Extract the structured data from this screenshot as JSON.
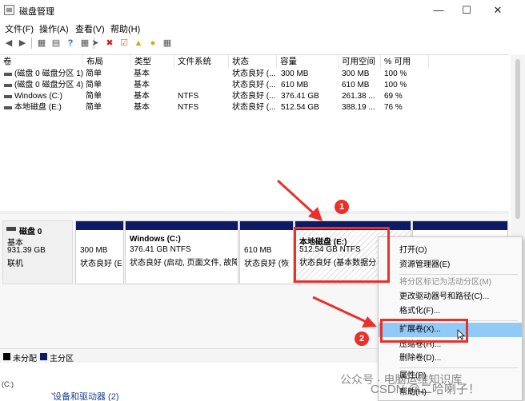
{
  "window": {
    "title": "磁盘管理",
    "controls": {
      "minimize": "—",
      "maximize": "☐",
      "close": "✕"
    }
  },
  "menu": [
    "文件(F)",
    "操作(A)",
    "查看(V)",
    "帮助(H)"
  ],
  "toolbar": {
    "icons": [
      "back-icon",
      "forward-icon",
      "console-tree-icon",
      "properties-icon",
      "help-icon",
      "view-icon",
      "connect-icon",
      "delete-icon",
      "checklist-icon",
      "open-folder-icon",
      "search-folder-icon",
      "options-icon"
    ]
  },
  "volume_table": {
    "columns": [
      "卷",
      "布局",
      "类型",
      "文件系统",
      "状态",
      "容量",
      "可用空间",
      "% 可用"
    ],
    "rows": [
      [
        "(磁盘 0 磁盘分区 1)",
        "简单",
        "基本",
        "",
        "状态良好 (...",
        "300 MB",
        "300 MB",
        "100 %"
      ],
      [
        "(磁盘 0 磁盘分区 4)",
        "简单",
        "基本",
        "",
        "状态良好 (...",
        "610 MB",
        "610 MB",
        "100 %"
      ],
      [
        "Windows (C:)",
        "简单",
        "基本",
        "NTFS",
        "状态良好 (...",
        "376.41 GB",
        "261.38 ...",
        "69 %"
      ],
      [
        "本地磁盘 (E:)",
        "简单",
        "基本",
        "NTFS",
        "状态良好 (...",
        "512.54 GB",
        "388.19 ...",
        "76 %"
      ]
    ]
  },
  "disk": {
    "name": "磁盘 0",
    "type": "基本",
    "size": "931.39 GB",
    "status": "联机",
    "partitions": [
      {
        "title": "",
        "size": "300 MB",
        "status": "状态良好 (E"
      },
      {
        "title": "Windows  (C:)",
        "size": "376.41 GB NTFS",
        "status": "状态良好 (启动, 页面文件, 故障"
      },
      {
        "title": "",
        "size": "610 MB",
        "status": "状态良好 (恢"
      },
      {
        "title": "本地磁盘  (E:)",
        "size": "512.54 GB NTFS",
        "status": "状态良好 (基本数据分"
      }
    ]
  },
  "legend": [
    {
      "label": "未分配",
      "color": "#000000"
    },
    {
      "label": "主分区",
      "color": "#0f1a66"
    }
  ],
  "behind_window": {
    "left_text": "(C:)",
    "section": "设备和驱动器 (2)"
  },
  "context_menu": {
    "items": [
      {
        "label": "打开(O)",
        "disabled": false
      },
      {
        "label": "资源管理器(E)",
        "disabled": false
      },
      {
        "label": "将分区标记为活动分区(M)",
        "disabled": true
      },
      {
        "label": "更改驱动器号和路径(C)...",
        "disabled": false
      },
      {
        "label": "格式化(F)...",
        "disabled": false
      },
      {
        "label": "扩展卷(X)...",
        "disabled": false,
        "highlighted": true
      },
      {
        "label": "压缩卷(H)...",
        "disabled": false
      },
      {
        "label": "删除卷(D)...",
        "disabled": false
      },
      {
        "label": "属性(P)",
        "disabled": false
      },
      {
        "label": "帮助(H)",
        "disabled": false
      }
    ]
  },
  "annotations": {
    "step1": "1",
    "step2": "2",
    "color": "#e8312b"
  },
  "watermarks": [
    "公众号 · 电脑运维知识库",
    "CSDN @二哈喇子！"
  ]
}
